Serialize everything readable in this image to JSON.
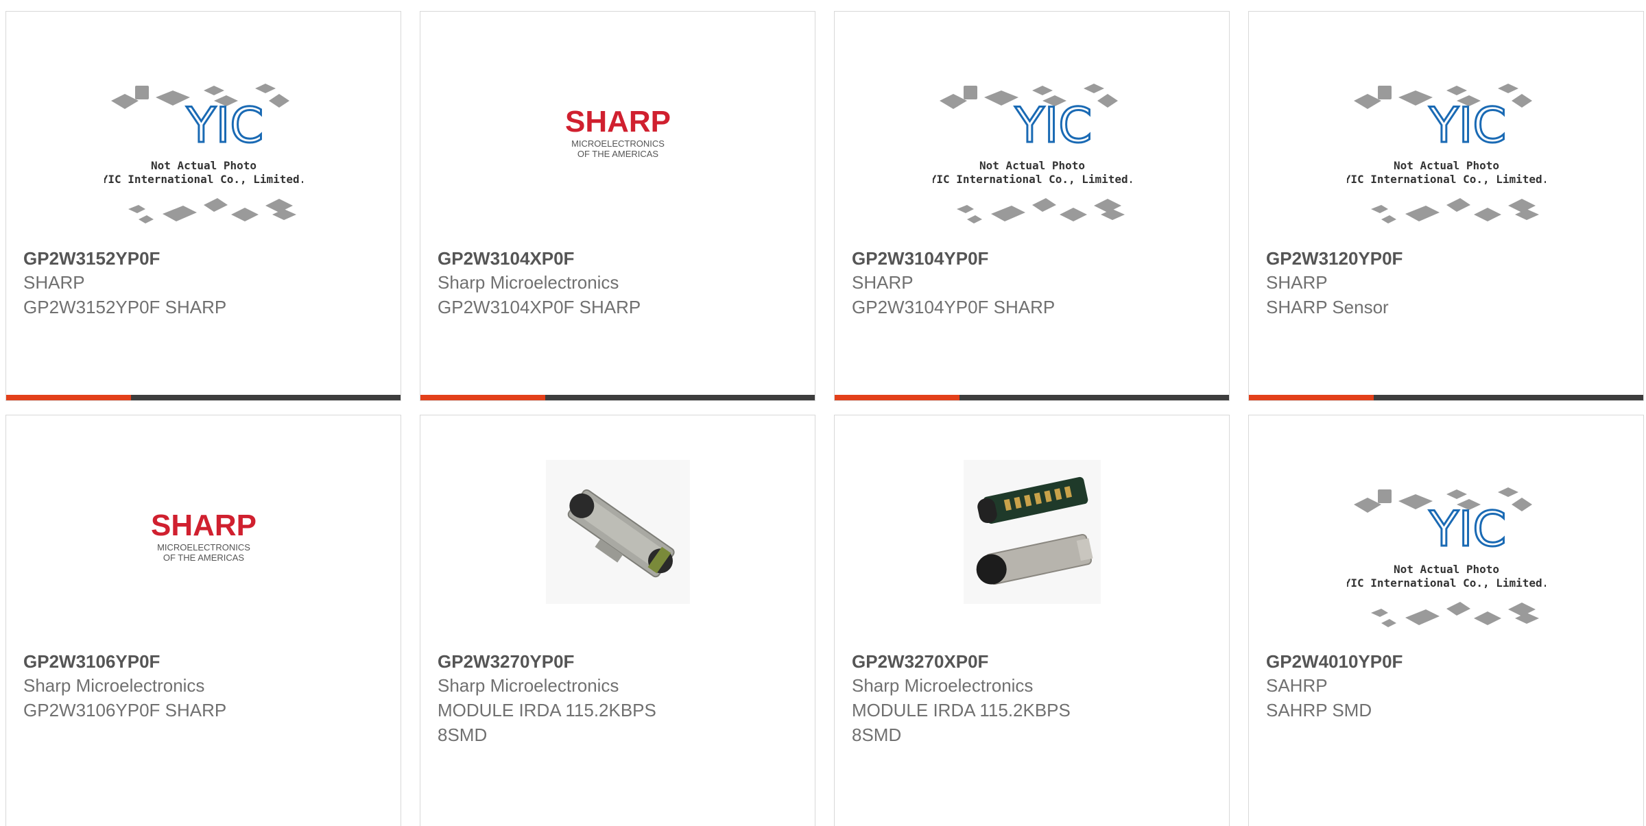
{
  "colors": {
    "accent": "#e3401a",
    "bar_dark": "#3d3d3d",
    "sharp_red": "#d0202f",
    "yic_blue": "#1a6ab4"
  },
  "placeholder": {
    "brand": "YIC",
    "line1": "Not Actual Photo",
    "line2": "YIC International Co., Limited."
  },
  "sharp_logo": {
    "word": "SHARP",
    "sub1": "MICROELECTRONICS",
    "sub2": "OF THE AMERICAS"
  },
  "products": [
    {
      "part_number": "GP2W3152YP0F",
      "manufacturer": "SHARP",
      "description": "GP2W3152YP0F SHARP",
      "image": "yic-placeholder"
    },
    {
      "part_number": "GP2W3104XP0F",
      "manufacturer": "Sharp Microelectronics",
      "description": "GP2W3104XP0F SHARP",
      "image": "sharp-logo"
    },
    {
      "part_number": "GP2W3104YP0F",
      "manufacturer": "SHARP",
      "description": "GP2W3104YP0F SHARP",
      "image": "yic-placeholder"
    },
    {
      "part_number": "GP2W3120YP0F",
      "manufacturer": "SHARP",
      "description": "SHARP Sensor",
      "image": "yic-placeholder"
    },
    {
      "part_number": "GP2W3106YP0F",
      "manufacturer": "Sharp Microelectronics",
      "description": "GP2W3106YP0F SHARP",
      "image": "sharp-logo"
    },
    {
      "part_number": "GP2W3270YP0F",
      "manufacturer": "Sharp Microelectronics",
      "description": "MODULE IRDA 115.2KBPS\n8SMD",
      "image": "irda-module-photo"
    },
    {
      "part_number": "GP2W3270XP0F",
      "manufacturer": "Sharp Microelectronics",
      "description": "MODULE IRDA 115.2KBPS\n8SMD",
      "image": "irda-module-pair-photo"
    },
    {
      "part_number": "GP2W4010YP0F",
      "manufacturer": "SAHRP",
      "description": "SAHRP SMD",
      "image": "yic-placeholder"
    }
  ]
}
